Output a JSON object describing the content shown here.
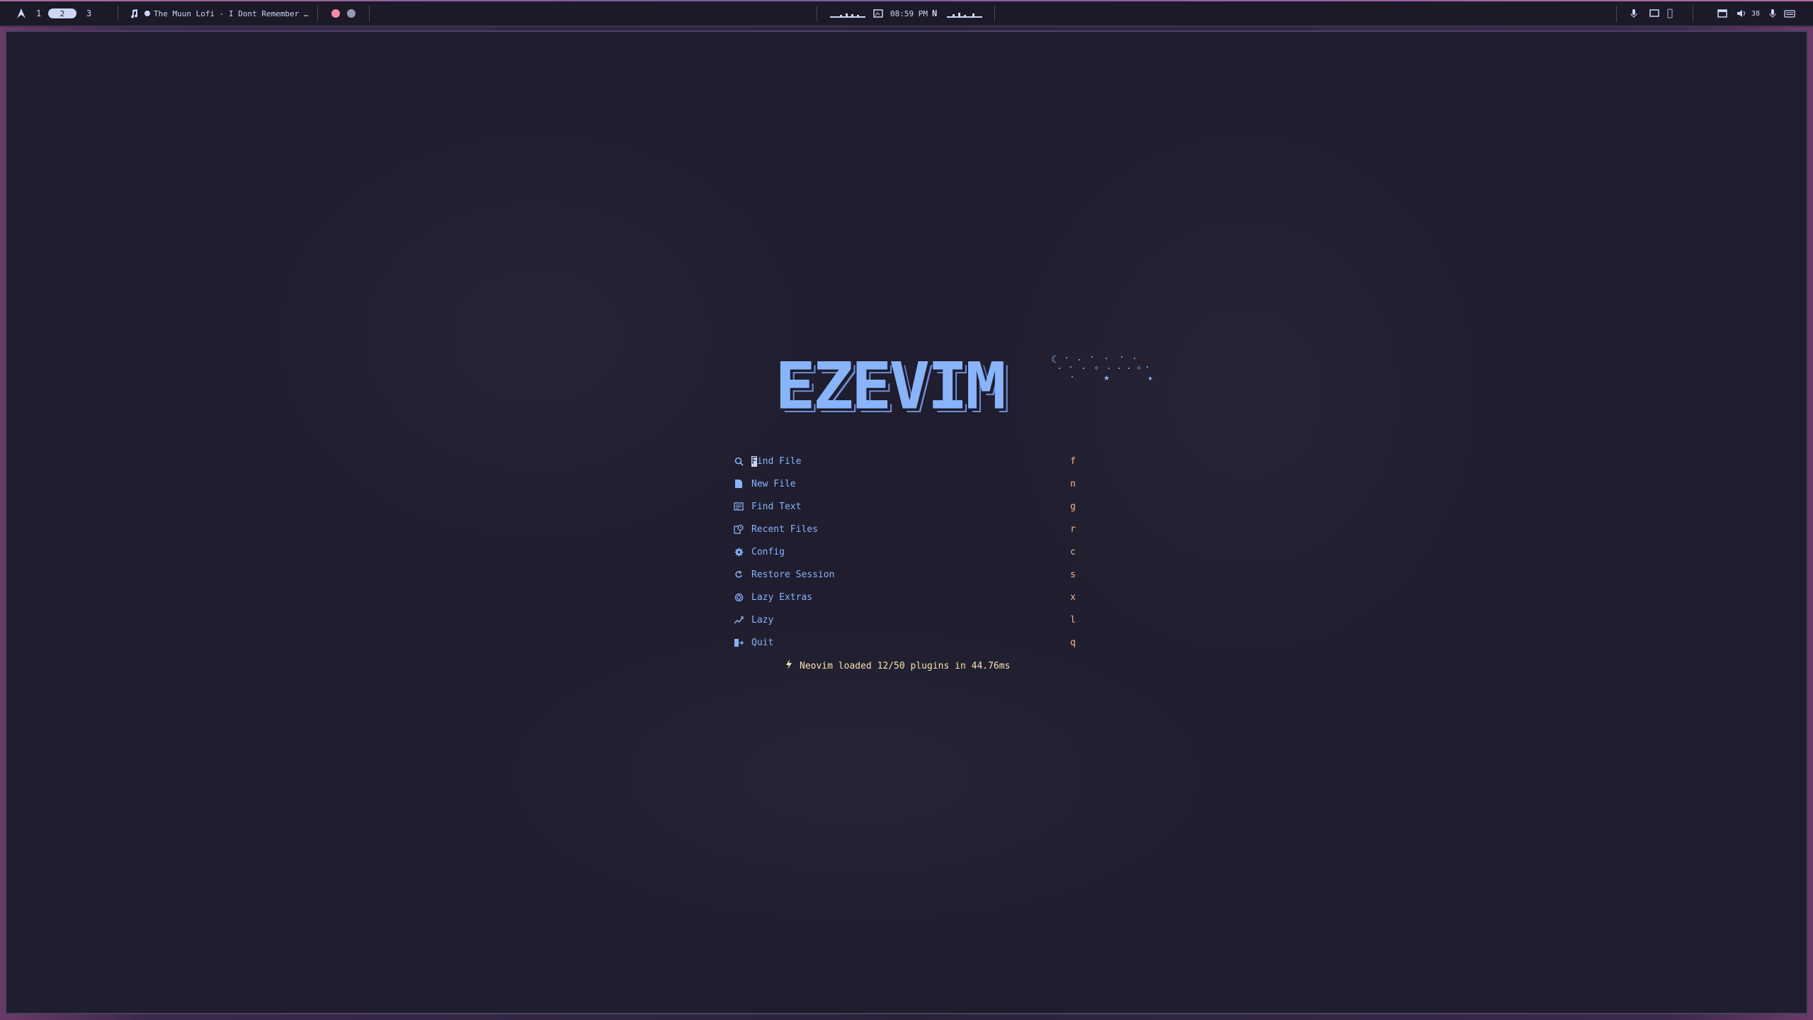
{
  "topbar": {
    "workspaces": [
      "1",
      "2",
      "3"
    ],
    "active_workspace": "2",
    "media_title": "The Muun Lofi - I Dont Remember …",
    "clock": "08:59 PM",
    "volume": "38",
    "colors": {
      "accent": "#a86aa0",
      "record": "#f38ba8"
    }
  },
  "dashboard": {
    "logo_text": "EZEVIM",
    "menu": [
      {
        "icon": "search-icon",
        "label": "Find File",
        "key": "f"
      },
      {
        "icon": "file-icon",
        "label": "New File",
        "key": "n"
      },
      {
        "icon": "text-search-icon",
        "label": "Find Text",
        "key": "g"
      },
      {
        "icon": "recent-files-icon",
        "label": "Recent Files",
        "key": "r"
      },
      {
        "icon": "gear-icon",
        "label": "Config",
        "key": "c"
      },
      {
        "icon": "restore-icon",
        "label": "Restore Session",
        "key": "s"
      },
      {
        "icon": "extras-icon",
        "label": "Lazy Extras",
        "key": "x"
      },
      {
        "icon": "lazy-icon",
        "label": "Lazy",
        "key": "l"
      },
      {
        "icon": "quit-icon",
        "label": "Quit",
        "key": "q"
      }
    ],
    "footer": "Neovim loaded 12/50 plugins in 44.76ms",
    "colors": {
      "label": "#89b4fa",
      "key": "#fab387",
      "footer": "#f9e2af",
      "background": "#1f1d2e"
    }
  }
}
